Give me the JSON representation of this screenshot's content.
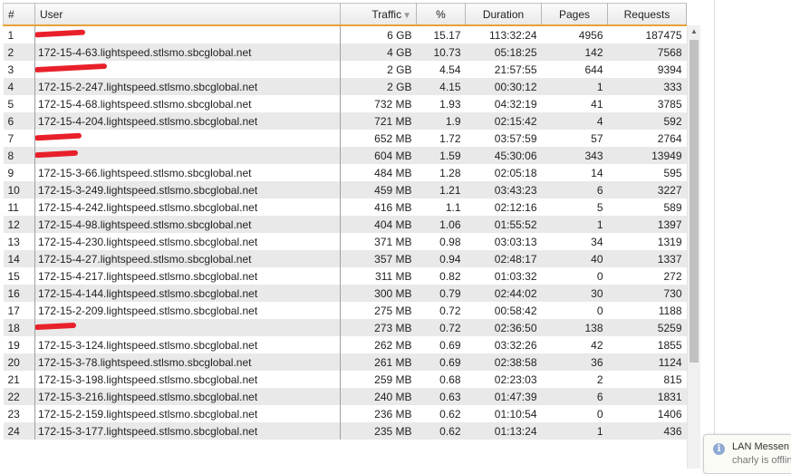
{
  "table": {
    "headers": {
      "num": "#",
      "user": "User",
      "traffic": "Traffic",
      "percent": "%",
      "duration": "Duration",
      "pages": "Pages",
      "requests": "Requests"
    },
    "sorted_column": "traffic",
    "sort_direction": "descending",
    "rows": [
      {
        "num": "1",
        "user": "",
        "redacted": true,
        "traffic": "6 GB",
        "percent": "15.17",
        "duration": "113:32:24",
        "pages": "4956",
        "requests": "187475"
      },
      {
        "num": "2",
        "user": "172-15-4-63.lightspeed.stlsmo.sbcglobal.net",
        "redacted": false,
        "traffic": "4 GB",
        "percent": "10.73",
        "duration": "05:18:25",
        "pages": "142",
        "requests": "7568"
      },
      {
        "num": "3",
        "user": "",
        "redacted": true,
        "traffic": "2 GB",
        "percent": "4.54",
        "duration": "21:57:55",
        "pages": "644",
        "requests": "9394"
      },
      {
        "num": "4",
        "user": "172-15-2-247.lightspeed.stlsmo.sbcglobal.net",
        "redacted": false,
        "traffic": "2 GB",
        "percent": "4.15",
        "duration": "00:30:12",
        "pages": "1",
        "requests": "333"
      },
      {
        "num": "5",
        "user": "172-15-4-68.lightspeed.stlsmo.sbcglobal.net",
        "redacted": false,
        "traffic": "732 MB",
        "percent": "1.93",
        "duration": "04:32:19",
        "pages": "41",
        "requests": "3785"
      },
      {
        "num": "6",
        "user": "172-15-4-204.lightspeed.stlsmo.sbcglobal.net",
        "redacted": false,
        "traffic": "721 MB",
        "percent": "1.9",
        "duration": "02:15:42",
        "pages": "4",
        "requests": "592"
      },
      {
        "num": "7",
        "user": "",
        "redacted": true,
        "traffic": "652 MB",
        "percent": "1.72",
        "duration": "03:57:59",
        "pages": "57",
        "requests": "2764"
      },
      {
        "num": "8",
        "user": "",
        "redacted": true,
        "traffic": "604 MB",
        "percent": "1.59",
        "duration": "45:30:06",
        "pages": "343",
        "requests": "13949"
      },
      {
        "num": "9",
        "user": "172-15-3-66.lightspeed.stlsmo.sbcglobal.net",
        "redacted": false,
        "traffic": "484 MB",
        "percent": "1.28",
        "duration": "02:05:18",
        "pages": "14",
        "requests": "595"
      },
      {
        "num": "10",
        "user": "172-15-3-249.lightspeed.stlsmo.sbcglobal.net",
        "redacted": false,
        "traffic": "459 MB",
        "percent": "1.21",
        "duration": "03:43:23",
        "pages": "6",
        "requests": "3227"
      },
      {
        "num": "11",
        "user": "172-15-4-242.lightspeed.stlsmo.sbcglobal.net",
        "redacted": false,
        "traffic": "416 MB",
        "percent": "1.1",
        "duration": "02:12:16",
        "pages": "5",
        "requests": "589"
      },
      {
        "num": "12",
        "user": "172-15-4-98.lightspeed.stlsmo.sbcglobal.net",
        "redacted": false,
        "traffic": "404 MB",
        "percent": "1.06",
        "duration": "01:55:52",
        "pages": "1",
        "requests": "1397"
      },
      {
        "num": "13",
        "user": "172-15-4-230.lightspeed.stlsmo.sbcglobal.net",
        "redacted": false,
        "traffic": "371 MB",
        "percent": "0.98",
        "duration": "03:03:13",
        "pages": "34",
        "requests": "1319"
      },
      {
        "num": "14",
        "user": "172-15-4-27.lightspeed.stlsmo.sbcglobal.net",
        "redacted": false,
        "traffic": "357 MB",
        "percent": "0.94",
        "duration": "02:48:17",
        "pages": "40",
        "requests": "1337"
      },
      {
        "num": "15",
        "user": "172-15-4-217.lightspeed.stlsmo.sbcglobal.net",
        "redacted": false,
        "traffic": "311 MB",
        "percent": "0.82",
        "duration": "01:03:32",
        "pages": "0",
        "requests": "272"
      },
      {
        "num": "16",
        "user": "172-15-4-144.lightspeed.stlsmo.sbcglobal.net",
        "redacted": false,
        "traffic": "300 MB",
        "percent": "0.79",
        "duration": "02:44:02",
        "pages": "30",
        "requests": "730"
      },
      {
        "num": "17",
        "user": "172-15-2-209.lightspeed.stlsmo.sbcglobal.net",
        "redacted": false,
        "traffic": "275 MB",
        "percent": "0.72",
        "duration": "00:58:42",
        "pages": "0",
        "requests": "1188"
      },
      {
        "num": "18",
        "user": "",
        "redacted": true,
        "traffic": "273 MB",
        "percent": "0.72",
        "duration": "02:36:50",
        "pages": "138",
        "requests": "5259"
      },
      {
        "num": "19",
        "user": "172-15-3-124.lightspeed.stlsmo.sbcglobal.net",
        "redacted": false,
        "traffic": "262 MB",
        "percent": "0.69",
        "duration": "03:32:26",
        "pages": "42",
        "requests": "1855"
      },
      {
        "num": "20",
        "user": "172-15-3-78.lightspeed.stlsmo.sbcglobal.net",
        "redacted": false,
        "traffic": "261 MB",
        "percent": "0.69",
        "duration": "02:38:58",
        "pages": "36",
        "requests": "1124"
      },
      {
        "num": "21",
        "user": "172-15-3-198.lightspeed.stlsmo.sbcglobal.net",
        "redacted": false,
        "traffic": "259 MB",
        "percent": "0.68",
        "duration": "02:23:03",
        "pages": "2",
        "requests": "815"
      },
      {
        "num": "22",
        "user": "172-15-3-216.lightspeed.stlsmo.sbcglobal.net",
        "redacted": false,
        "traffic": "240 MB",
        "percent": "0.63",
        "duration": "01:47:39",
        "pages": "6",
        "requests": "1831"
      },
      {
        "num": "23",
        "user": "172-15-2-159.lightspeed.stlsmo.sbcglobal.net",
        "redacted": false,
        "traffic": "236 MB",
        "percent": "0.62",
        "duration": "01:10:54",
        "pages": "0",
        "requests": "1406"
      },
      {
        "num": "24",
        "user": "172-15-3-177.lightspeed.stlsmo.sbcglobal.net",
        "redacted": false,
        "traffic": "235 MB",
        "percent": "0.62",
        "duration": "01:13:24",
        "pages": "1",
        "requests": "436"
      }
    ]
  },
  "colors": {
    "header_underline": "#e8a13a",
    "row_alt": "#e9e9e9",
    "redaction": "#e8202a",
    "scroll_thumb": "#c1c1c1"
  },
  "icons": {
    "sort_indicator": "sort-descending-icon",
    "toast_icon": "info-icon",
    "scroll_up": "scroll-up-arrow-icon"
  },
  "notification": {
    "title": "LAN Messen",
    "subtitle": "charly is offlin"
  }
}
